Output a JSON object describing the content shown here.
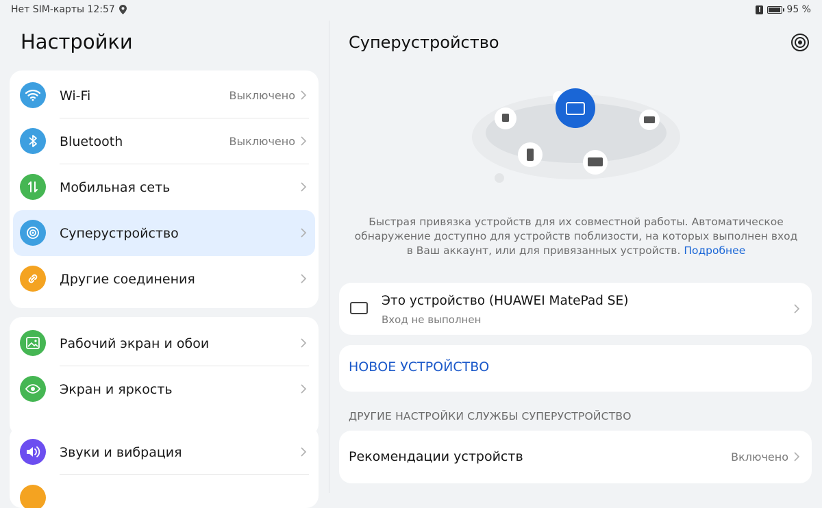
{
  "status_bar": {
    "left_text": "Нет SIM-карты 12:57",
    "location_icon": "location-pin-icon",
    "battery_percent_text": "95 %",
    "battery_level": 0.95
  },
  "settings": {
    "title": "Настройки",
    "groups": [
      {
        "items": [
          {
            "label": "Wi-Fi",
            "value": "Выключено",
            "icon": "wifi-icon",
            "color": "#3d9fe0"
          },
          {
            "label": "Bluetooth",
            "value": "Выключено",
            "icon": "bluetooth-icon",
            "color": "#3d9fe0"
          },
          {
            "label": "Мобильная сеть",
            "value": "",
            "icon": "mobile-network-icon",
            "color": "#45b653"
          },
          {
            "label": "Суперустройство",
            "value": "",
            "icon": "superdevice-icon",
            "color": "#3d9fe0",
            "selected": true
          },
          {
            "label": "Другие соединения",
            "value": "",
            "icon": "link-icon",
            "color": "#f4a321"
          }
        ]
      },
      {
        "items": [
          {
            "label": "Рабочий экран и обои",
            "value": "",
            "icon": "wallpaper-icon",
            "color": "#45b653"
          },
          {
            "label": "Экран и яркость",
            "value": "",
            "icon": "eye-icon",
            "color": "#45b653"
          }
        ]
      },
      {
        "items": [
          {
            "label": "Звуки и вибрация",
            "value": "",
            "icon": "speaker-icon",
            "color": "#6c4ef0"
          }
        ]
      }
    ]
  },
  "detail": {
    "title": "Суперустройство",
    "description": "Быстрая привязка устройств для их совместной работы. Автоматическое обнаружение доступно для устройств поблизости, на которых выполнен вход в Ваш аккаунт, или для привязанных устройств.",
    "learn_more": "Подробнее",
    "this_device": {
      "name": "Это устройство (HUAWEI MatePad SE)",
      "status": "Вход не выполнен"
    },
    "new_device_button": "НОВОЕ УСТРОЙСТВО",
    "other_settings_header": "ДРУГИЕ НАСТРОЙКИ СЛУЖБЫ СУПЕРУСТРОЙСТВО",
    "recommendations": {
      "label": "Рекомендации устройств",
      "value": "Включено"
    }
  },
  "colors": {
    "accent": "#1a66d6",
    "selected_row": "#e3efff",
    "background": "#f1f3f5"
  }
}
